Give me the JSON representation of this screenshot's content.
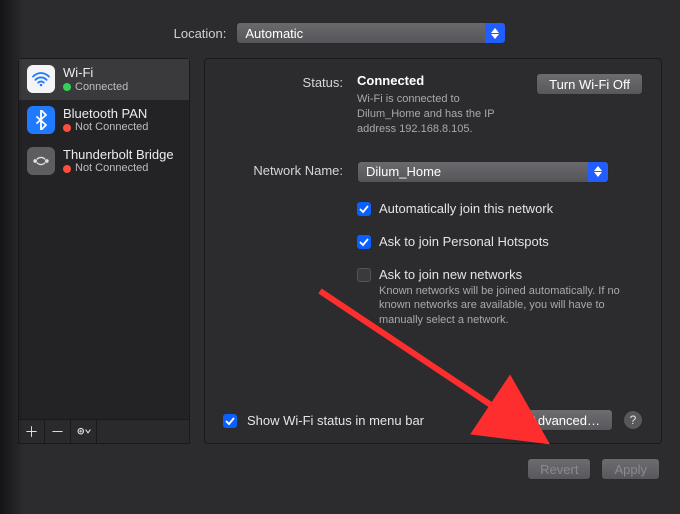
{
  "location": {
    "label": "Location:",
    "value": "Automatic"
  },
  "sidebar": {
    "items": [
      {
        "name": "Wi-Fi",
        "status": "Connected",
        "statusColor": "green",
        "icon": "wifi"
      },
      {
        "name": "Bluetooth PAN",
        "status": "Not Connected",
        "statusColor": "red",
        "icon": "bt"
      },
      {
        "name": "Thunderbolt Bridge",
        "status": "Not Connected",
        "statusColor": "red",
        "icon": "tb"
      }
    ]
  },
  "panel": {
    "statusLabel": "Status:",
    "statusValue": "Connected",
    "toggleButton": "Turn Wi-Fi Off",
    "statusDesc": "Wi-Fi is connected to Dilum_Home and has the IP address 192.168.8.105.",
    "networkLabel": "Network Name:",
    "networkValue": "Dilum_Home",
    "checks": {
      "autoJoin": {
        "label": "Automatically join this network",
        "on": true
      },
      "hotspots": {
        "label": "Ask to join Personal Hotspots",
        "on": true
      },
      "newNetworks": {
        "label": "Ask to join new networks",
        "on": false,
        "desc": "Known networks will be joined automatically. If no known networks are available, you will have to manually select a network."
      }
    },
    "menuBar": {
      "label": "Show Wi-Fi status in menu bar",
      "on": true
    },
    "advanced": "Advanced…",
    "help": "?"
  },
  "footer": {
    "revert": "Revert",
    "apply": "Apply"
  }
}
